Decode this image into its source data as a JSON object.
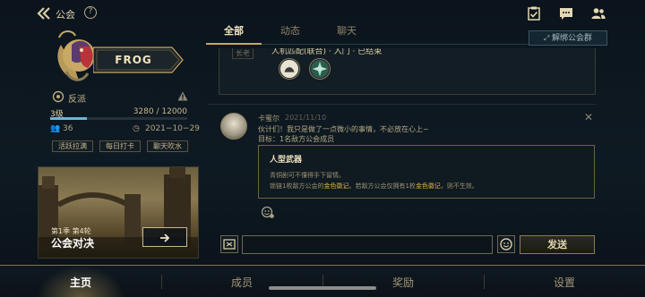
{
  "header": {
    "title": "公会",
    "help_symbol": "?",
    "icons": [
      "checklist-icon",
      "chat-bubble-icon",
      "members-icon"
    ]
  },
  "tabs": [
    {
      "label": "全部",
      "active": true
    },
    {
      "label": "动态",
      "active": false
    },
    {
      "label": "聊天",
      "active": false
    }
  ],
  "unbind_button": "解绑公会群",
  "guild": {
    "name": "FROG",
    "faction": "反派",
    "level": "3级",
    "exp_text": "3280 / 12000",
    "exp_fraction": 0.27,
    "member_count": "36",
    "founded": "2021−10−29",
    "chips": [
      "活跃拉满",
      "每日打卡",
      "聊天吹水"
    ]
  },
  "event": {
    "season": "第1季 第4轮",
    "title": "公会对决",
    "go_symbol": "›"
  },
  "feed": {
    "pinned": {
      "tag": "长老",
      "text": "人机匹配(联合) · 入门 · 已结束"
    },
    "post": {
      "author": "卡蜜尔",
      "date": "2021/11/10",
      "lines": [
        "伙计们！我只是做了一点微小的事情，不必放在心上~",
        "目标：1名敌方公会成员"
      ],
      "card_title": "人型武器",
      "card_line1": "青铜剧可不懂得手下留情。",
      "card_line2_a": "锁链1枚敌方公会的",
      "card_line2_hl1": "金色徽记",
      "card_line2_b": "。若敌方公会仅拥有1枚",
      "card_line2_hl2": "金色徽记",
      "card_line2_c": "，则不生效。",
      "close_symbol": "✕"
    }
  },
  "input": {
    "placeholder": "",
    "send_label": "发送"
  },
  "bottom_nav": [
    {
      "label": "主页",
      "active": true
    },
    {
      "label": "成员",
      "active": false
    },
    {
      "label": "奖励",
      "active": false
    },
    {
      "label": "设置",
      "active": false
    }
  ],
  "colors": {
    "accent_gold": "#c9a865",
    "exp_blue": "#6fb5d6",
    "highlight": "#e0b440"
  }
}
